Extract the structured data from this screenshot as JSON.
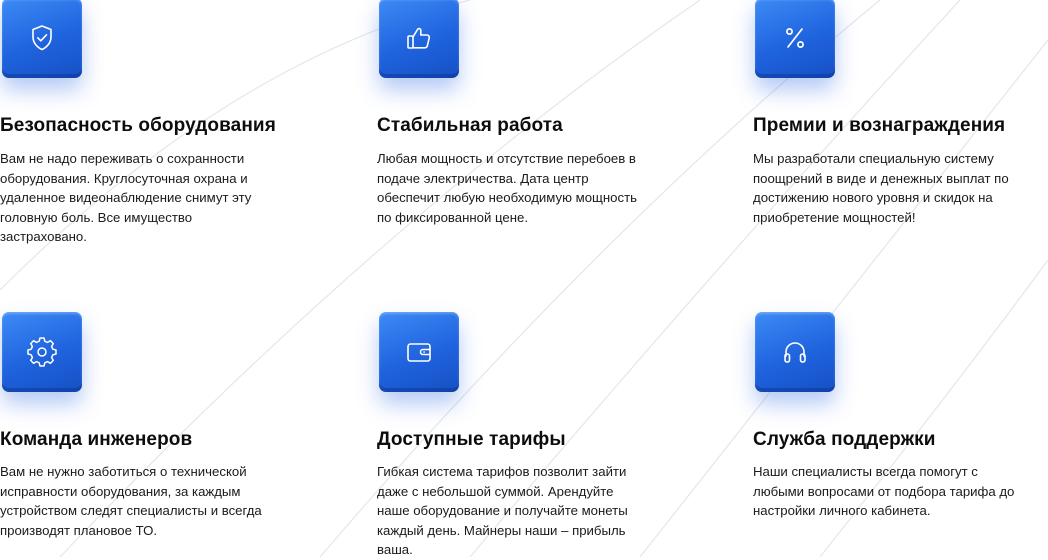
{
  "features": [
    {
      "icon": "shield-check-icon",
      "title": "Безопасность оборудования",
      "desc_lines": [
        "Вам не надо переживать о сохранности",
        "оборудования. Круглосуточная охрана и",
        "удаленное видеонаблюдение снимут эту",
        "головную боль. Все имущество",
        "застраховано."
      ]
    },
    {
      "icon": "thumbs-up-icon",
      "title": "Стабильная работа",
      "desc_lines": [
        "Любая мощность и отсутствие перебоев в",
        "подаче электричества. Дата центр",
        "обеспечит любую необходимую мощность",
        "по фиксированной цене."
      ]
    },
    {
      "icon": "percent-icon",
      "title": "Премии и вознаграждения",
      "desc_lines": [
        "Мы разработали специальную систему",
        "поощрений в виде и денежных выплат по",
        "достижению нового уровня и скидок на",
        "приобретение мощностей!"
      ]
    },
    {
      "icon": "gear-icon",
      "title": "Команда инженеров",
      "desc_lines": [
        "Вам не нужно заботиться о технической",
        "исправности оборудования, за каждым",
        "устройством следят специалисты и всегда",
        "производят плановое ТО."
      ]
    },
    {
      "icon": "wallet-icon",
      "title": "Доступные тарифы",
      "desc_lines": [
        "Гибкая система тарифов позволит зайти",
        "даже с небольшой суммой. Арендуйте",
        "наше оборудование и получайте монеты",
        "каждый день. Майнеры наши – прибыль",
        "ваша."
      ]
    },
    {
      "icon": "headphones-icon",
      "title": "Служба поддержки",
      "desc_lines": [
        "Наши специалисты всегда помогут с",
        "любыми вопросами от подбора тарифа до",
        "настройки личного кабинета."
      ]
    }
  ]
}
